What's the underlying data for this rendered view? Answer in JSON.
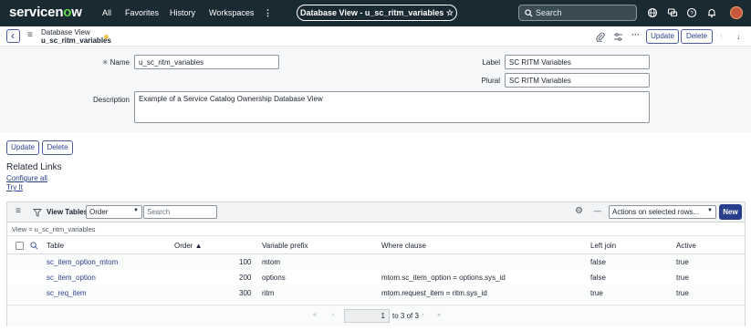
{
  "topnav": {
    "logo_text": "servicen",
    "logo_o": "o",
    "logo_tail": "w",
    "items": [
      "All",
      "Favorites",
      "History",
      "Workspaces"
    ],
    "more_glyph": "⋮",
    "record_title": "Database View - u_sc_ritm_variables ☆",
    "search_placeholder": "Search",
    "icons": [
      "globe-icon",
      "chat-icon",
      "help-icon",
      "bell-icon"
    ]
  },
  "header": {
    "back_glyph": "‹",
    "menu_glyph": "≡",
    "table_label": "Database View",
    "record_name": "u_sc_ritm_variables",
    "attach_glyph": "⌕",
    "settings_glyph": "⇌",
    "more_glyph": "···",
    "update_label": "Update",
    "delete_label": "Delete",
    "up_glyph": "↑",
    "down_glyph": "↓"
  },
  "form": {
    "name_label": "Name",
    "required_glyph": "✳",
    "name_value": "u_sc_ritm_variables",
    "label_label": "Label",
    "label_value": "SC RITM Variables",
    "plural_label": "Plural",
    "plural_value": "SC RITM Variables",
    "description_label": "Description",
    "description_value": "Example of a Service Catalog Ownership Database View"
  },
  "actions": {
    "update_label": "Update",
    "delete_label": "Delete"
  },
  "related_links": {
    "title": "Related Links",
    "links": [
      "Configure all",
      "Try It"
    ]
  },
  "list": {
    "menu_glyph": "≡",
    "filter_glyph": "⊽",
    "title": "View Tables",
    "field_select": "Order",
    "search_placeholder": "Search",
    "gear_glyph": "⚙",
    "minus_glyph": "—",
    "actions_select": "Actions on selected rows...",
    "new_label": "New",
    "breadcrumb": "View = u_sc_ritm_variables",
    "columns": {
      "table": "Table",
      "order": "Order ▲",
      "variable_prefix": "Variable prefix",
      "where_clause": "Where clause",
      "left_join": "Left join",
      "active": "Active"
    },
    "rows": [
      {
        "table": "sc_item_option_mtom",
        "order": "100",
        "prefix": "mtom",
        "where": "",
        "left_join": "false",
        "active": "true"
      },
      {
        "table": "sc_item_option",
        "order": "200",
        "prefix": "options",
        "where": "mtom.sc_item_option = options.sys_id",
        "left_join": "false",
        "active": "true"
      },
      {
        "table": "sc_req_item",
        "order": "300",
        "prefix": "ritm",
        "where": "mtom.request_item = ritm.sys_id",
        "left_join": "true",
        "active": "true"
      }
    ],
    "pager": {
      "first": "«",
      "prev": "‹",
      "current": "1",
      "range_text": "to 3 of 3",
      "next": "›",
      "last": "»"
    }
  },
  "colors": {
    "nav_bg": "#1a2a32",
    "link": "#293e8c",
    "new_button": "#293e8c",
    "logo_accent": "#62d84e"
  }
}
